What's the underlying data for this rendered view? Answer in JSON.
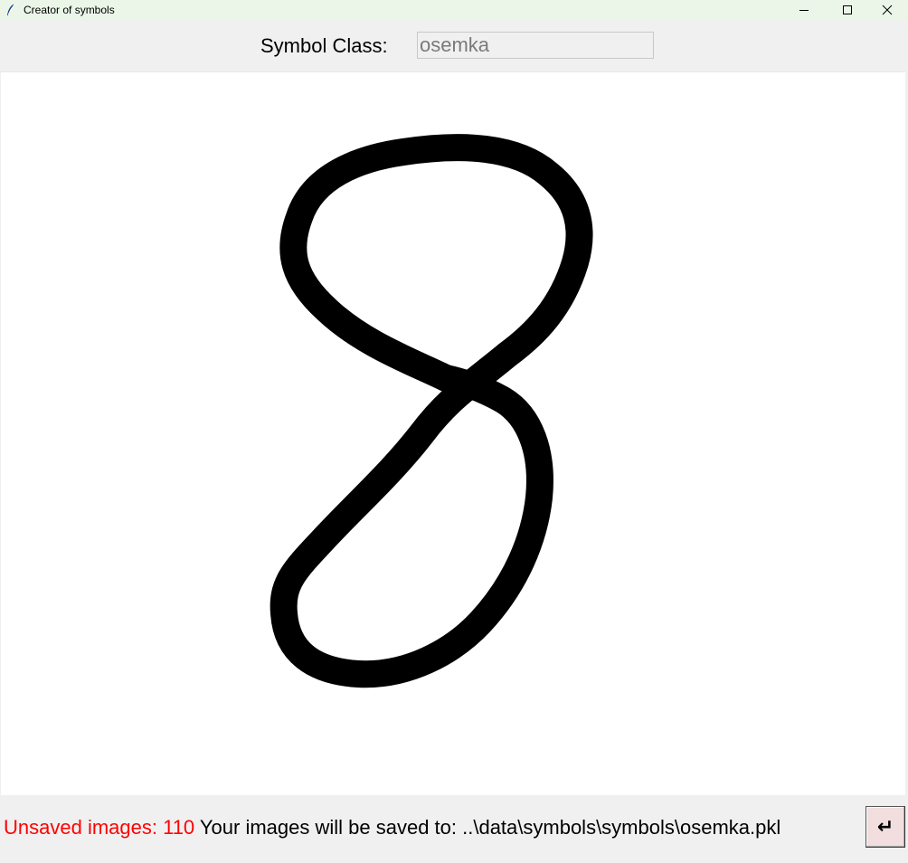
{
  "window": {
    "title": "Creator of symbols",
    "icon": "feather-icon",
    "controls": [
      "minimize-icon",
      "maximize-icon",
      "close-icon"
    ]
  },
  "header": {
    "symbol_class_label": "Symbol Class:",
    "symbol_class_value": "osemka"
  },
  "canvas": {
    "drawn_symbol": "8",
    "stroke_color": "#000000",
    "background": "#ffffff"
  },
  "footer": {
    "unsaved_text": "Unsaved images: 110",
    "save_path_text": " Your images will be saved to: ..\\data\\symbols\\symbols\\osemka.pkl",
    "enter_button_label": "↵",
    "unsaved_color": "#ff0000",
    "enter_button_bg": "#f2dede"
  }
}
